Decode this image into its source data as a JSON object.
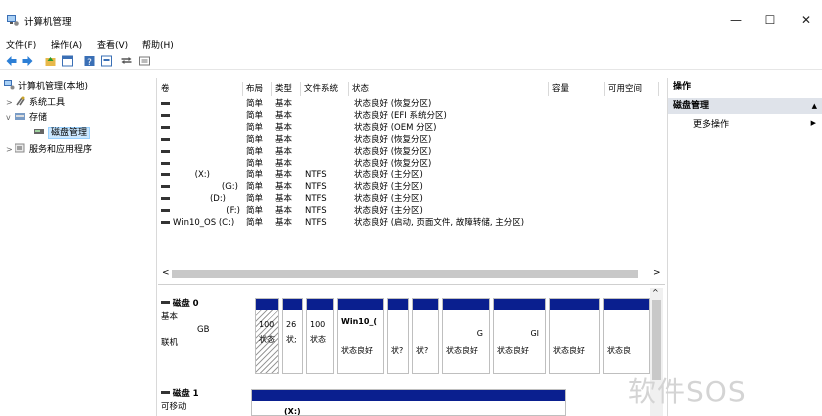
{
  "window": {
    "title": "计算机管理",
    "minimize": "—",
    "maximize": "☐",
    "close": "✕"
  },
  "menu": [
    "文件(F)",
    "操作(A)",
    "查看(V)",
    "帮助(H)"
  ],
  "toolbar_icons": [
    "back-icon",
    "forward-icon",
    "up-folder-icon",
    "console-tree-icon",
    "help-icon",
    "properties-icon",
    "connect-icon",
    "list-view-icon"
  ],
  "tree": {
    "root": "计算机管理(本地)",
    "system_tools": "系统工具",
    "storage": "存储",
    "disk_management": "磁盘管理",
    "services": "服务和应用程序"
  },
  "volume_table": {
    "columns": [
      "卷",
      "布局",
      "类型",
      "文件系统",
      "状态",
      "容量",
      "可用空间"
    ],
    "rows": [
      {
        "volume": "",
        "layout": "简单",
        "type": "基本",
        "fs": "",
        "status": "状态良好 (恢复分区)"
      },
      {
        "volume": "",
        "layout": "简单",
        "type": "基本",
        "fs": "",
        "status": "状态良好 (EFI 系统分区)"
      },
      {
        "volume": "",
        "layout": "简单",
        "type": "基本",
        "fs": "",
        "status": "状态良好 (OEM 分区)"
      },
      {
        "volume": "",
        "layout": "简单",
        "type": "基本",
        "fs": "",
        "status": "状态良好 (恢复分区)"
      },
      {
        "volume": "",
        "layout": "简单",
        "type": "基本",
        "fs": "",
        "status": "状态良好 (恢复分区)"
      },
      {
        "volume": "",
        "layout": "简单",
        "type": "基本",
        "fs": "",
        "status": "状态良好 (恢复分区)"
      },
      {
        "volume": "(X:)",
        "layout": "简单",
        "type": "基本",
        "fs": "NTFS",
        "status": "状态良好 (主分区)"
      },
      {
        "volume": "(G:)",
        "layout": "简单",
        "type": "基本",
        "fs": "NTFS",
        "status": "状态良好 (主分区)"
      },
      {
        "volume": "(D:)",
        "layout": "简单",
        "type": "基本",
        "fs": "NTFS",
        "status": "状态良好 (主分区)"
      },
      {
        "volume": "(F:)",
        "layout": "简单",
        "type": "基本",
        "fs": "NTFS",
        "status": "状态良好 (主分区)"
      },
      {
        "volume": "Win10_OS (C:)",
        "layout": "简单",
        "type": "基本",
        "fs": "NTFS",
        "status": "状态良好 (启动, 页面文件, 故障转储, 主分区)"
      }
    ]
  },
  "disk0": {
    "name": "磁盘 0",
    "kind": "基本",
    "size": "GB",
    "state": "联机",
    "partitions": [
      {
        "top": "100",
        "bottom": "状态"
      },
      {
        "top": "26",
        "bottom": "状;"
      },
      {
        "top": "100",
        "bottom": "状态"
      },
      {
        "top": "Win10_(",
        "bottom": "状态良好"
      },
      {
        "top": "",
        "bottom": "状?"
      },
      {
        "top": "",
        "bottom": "状?"
      },
      {
        "top": "G",
        "bottom": "状态良好"
      },
      {
        "top": "GI",
        "bottom": "状态良好"
      },
      {
        "top": "",
        "bottom": "状态良好"
      },
      {
        "top": "",
        "bottom": "状态良"
      }
    ]
  },
  "disk1": {
    "name": "磁盘 1",
    "kind": "可移动",
    "volume": "(X:)"
  },
  "actions": {
    "header": "操作",
    "section": "磁盘管理",
    "more": "更多操作"
  },
  "watermark": "软件SOS"
}
